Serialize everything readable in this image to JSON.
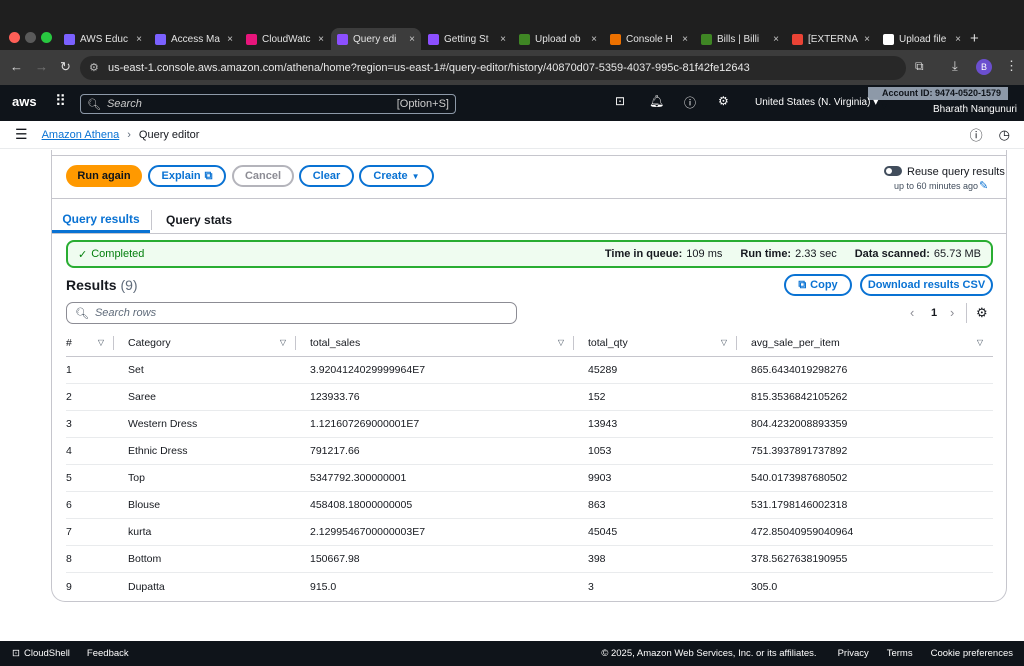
{
  "browser": {
    "tabs": [
      {
        "title": "AWS Educ",
        "color": "#7b61ff"
      },
      {
        "title": "Access Ma",
        "color": "#7b61ff"
      },
      {
        "title": "CloudWatc",
        "color": "#e7157b"
      },
      {
        "title": "Query edi",
        "color": "#8c4fff",
        "active": true
      },
      {
        "title": "Getting St",
        "color": "#8c4fff"
      },
      {
        "title": "Upload ob",
        "color": "#3f8624"
      },
      {
        "title": "Console H",
        "color": "#ed7100"
      },
      {
        "title": "Bills | Billi",
        "color": "#3f8624"
      },
      {
        "title": "[EXTERNA",
        "color": "#ea4335"
      },
      {
        "title": "Upload file",
        "color": "#ffffff"
      }
    ],
    "new_tab": "+",
    "url": "us-east-1.console.aws.amazon.com/athena/home?region=us-east-1#/query-editor/history/40870d07-5359-4037-995c-81f42fe12643",
    "profile_initial": "B"
  },
  "aws_header": {
    "logo": "aws",
    "search_placeholder": "Search",
    "search_shortcut": "[Option+S]",
    "region": "United States (N. Virginia)",
    "account_id": "Account ID: 9474-0520-1579",
    "user": "Bharath Nangunuri"
  },
  "breadcrumb": {
    "service": "Amazon Athena",
    "page": "Query editor"
  },
  "toolbar": {
    "run_again": "Run again",
    "explain": "Explain",
    "cancel": "Cancel",
    "clear": "Clear",
    "create": "Create",
    "reuse_label": "Reuse query results",
    "reuse_sub": "up to 60 minutes ago",
    "reuse_enabled": false
  },
  "tabs": {
    "results": "Query results",
    "stats": "Query stats",
    "active": "results"
  },
  "status": {
    "state": "Completed",
    "queue_label": "Time in queue:",
    "queue_value": "109 ms",
    "run_label": "Run time:",
    "run_value": "2.33 sec",
    "scanned_label": "Data scanned:",
    "scanned_value": "65.73 MB",
    "color": "#29ad32"
  },
  "results": {
    "title": "Results",
    "count": "(9)",
    "copy": "Copy",
    "download": "Download results CSV",
    "search_placeholder": "Search rows",
    "page": "1"
  },
  "table": {
    "columns": [
      "#",
      "Category",
      "total_sales",
      "total_qty",
      "avg_sale_per_item"
    ],
    "rows": [
      [
        "1",
        "Set",
        "3.9204124029999964E7",
        "45289",
        "865.6434019298276"
      ],
      [
        "2",
        "Saree",
        "123933.76",
        "152",
        "815.3536842105262"
      ],
      [
        "3",
        "Western Dress",
        "1.121607269000001E7",
        "13943",
        "804.4232008893359"
      ],
      [
        "4",
        "Ethnic Dress",
        "791217.66",
        "1053",
        "751.3937891737892"
      ],
      [
        "5",
        "Top",
        "5347792.300000001",
        "9903",
        "540.0173987680502"
      ],
      [
        "6",
        "Blouse",
        "458408.18000000005",
        "863",
        "531.1798146002318"
      ],
      [
        "7",
        "kurta",
        "2.1299546700000003E7",
        "45045",
        "472.85040959040964"
      ],
      [
        "8",
        "Bottom",
        "150667.98",
        "398",
        "378.5627638190955"
      ],
      [
        "9",
        "Dupatta",
        "915.0",
        "3",
        "305.0"
      ]
    ]
  },
  "footer": {
    "cloudshell": "CloudShell",
    "feedback": "Feedback",
    "copyright": "© 2025, Amazon Web Services, Inc. or its affiliates.",
    "privacy": "Privacy",
    "terms": "Terms",
    "cookies": "Cookie preferences"
  }
}
